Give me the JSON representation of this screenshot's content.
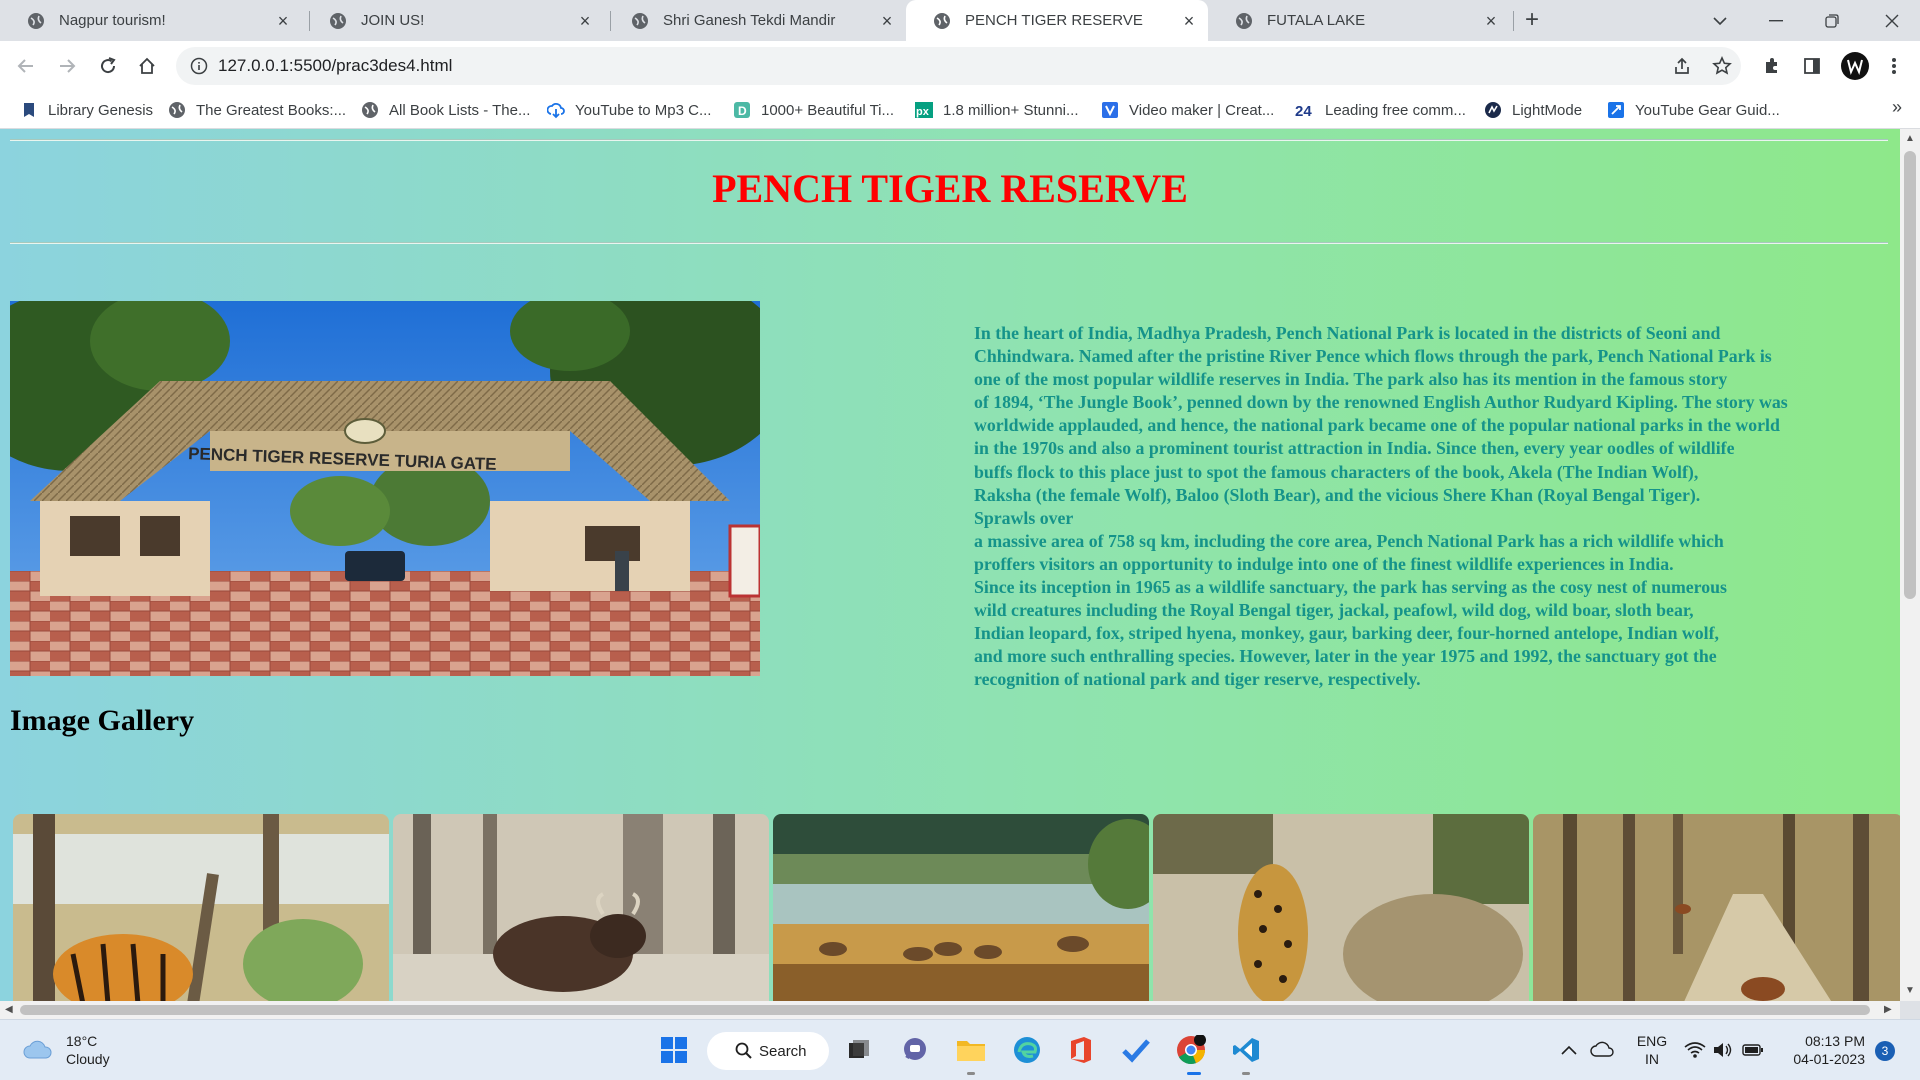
{
  "browser": {
    "tabs": [
      {
        "title": "Nagpur tourism!",
        "active": false
      },
      {
        "title": "JOIN US!",
        "active": false
      },
      {
        "title": "Shri Ganesh Tekdi Mandir",
        "active": false
      },
      {
        "title": "PENCH TIGER RESERVE",
        "active": true
      },
      {
        "title": "FUTALA LAKE",
        "active": false
      }
    ],
    "url": "127.0.0.1:5500/prac3des4.html",
    "bookmarks": [
      {
        "label": "Library Genesis",
        "icon": "library-genesis-icon"
      },
      {
        "label": "The Greatest Books:...",
        "icon": "globe-icon"
      },
      {
        "label": "All Book Lists - The...",
        "icon": "globe-icon"
      },
      {
        "label": "YouTube to Mp3 C...",
        "icon": "cloud-download-icon"
      },
      {
        "label": "1000+ Beautiful Ti...",
        "icon": "d-icon"
      },
      {
        "label": "1.8 million+ Stunni...",
        "icon": "px-icon"
      },
      {
        "label": "Video maker | Creat...",
        "icon": "v-icon"
      },
      {
        "label": "Leading free comm...",
        "icon": "24-icon"
      },
      {
        "label": "LightMode",
        "icon": "lightmode-icon"
      },
      {
        "label": "YouTube Gear Guid...",
        "icon": "kit-icon"
      }
    ]
  },
  "page": {
    "title": "PENCH TIGER RESERVE",
    "hero_sign": "PENCH TIGER RESERVE TURIA GATE",
    "article": "In the heart of India, Madhya Pradesh, Pench National Park is located in the districts of Seoni and\nChhindwara. Named after the pristine River Pence which flows through the park, Pench National Park is\none of the most popular wildlife reserves in India. The park also has its mention in the famous story\nof 1894, ‘The Jungle Book’, penned down by the renowned English Author Rudyard Kipling. The story was\nworldwide applauded, and hence, the national park became one of the popular national parks in the world\nin the 1970s and also a prominent tourist attraction in India. Since then, every year oodles of wildlife\nbuffs flock to this place just to spot the famous characters of the book, Akela (The Indian Wolf),\nRaksha (the female Wolf), Baloo (Sloth Bear), and the vicious Shere Khan (Royal Bengal Tiger).\nSprawls over\na massive area of 758 sq km, including the core area, Pench National Park has a rich wildlife which\nproffers visitors an opportunity to indulge into one of the finest wildlife experiences in India.\nSince its inception in 1965 as a wildlife sanctuary, the park has serving as the cosy nest of numerous\nwild creatures including the Royal Bengal tiger, jackal, peafowl, wild dog, wild boar, sloth bear,\nIndian leopard, fox, striped hyena, monkey, gaur, barking deer, four-horned antelope, Indian wolf,\nand more such enthralling species. However, later in the year 1975 and 1992, the sanctuary got the\nrecognition of national park and tiger reserve, respectively.",
    "gallery_heading": "Image Gallery",
    "colors": {
      "title": "#ff0000",
      "article": "#15938a"
    }
  },
  "taskbar": {
    "weather_temp": "18°C",
    "weather_desc": "Cloudy",
    "search_label": "Search",
    "lang_top": "ENG",
    "lang_bottom": "IN",
    "time": "08:13 PM",
    "date": "04-01-2023",
    "notif_count": "3"
  }
}
